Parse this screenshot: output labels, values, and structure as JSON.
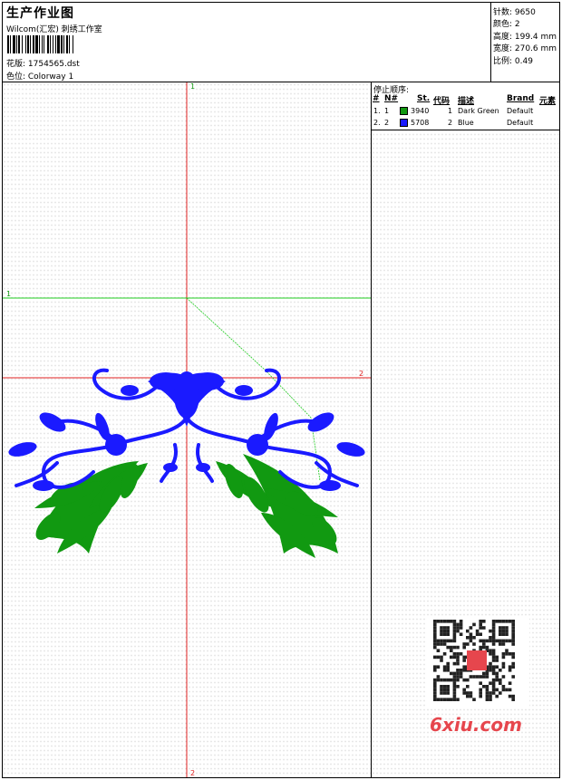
{
  "header": {
    "title": "生产作业图",
    "studio": "Wilcom(汇宏) 刺绣工作室",
    "file_label": "花版: 1754565.dst",
    "colorway_label": "色位: Colorway 1"
  },
  "stats": {
    "stitches": "针数: 9650",
    "colors": "颜色: 2",
    "height": "高度: 199.4 mm",
    "width": "宽度: 270.6 mm",
    "scale": "比例: 0.49"
  },
  "stop_sequence": {
    "caption": "停止顺序:",
    "headers": [
      "#",
      "N#",
      "St.",
      "代码",
      "描述",
      "Brand",
      "元素"
    ],
    "rows": [
      {
        "idx": "1.",
        "n": "1",
        "color": "#119911",
        "st": "3940",
        "code": "1",
        "desc": "Dark Green",
        "brand": "Default"
      },
      {
        "idx": "2.",
        "n": "2",
        "color": "#1a1aff",
        "st": "5708",
        "code": "2",
        "desc": "Blue",
        "brand": "Default"
      }
    ]
  },
  "axis_labels": {
    "v_top": "1",
    "v_bottom": "2",
    "h_left": "1",
    "h_right": "2"
  },
  "colors": {
    "green": "#119911",
    "blue": "#1a1aff",
    "red_axis": "#e02020",
    "green_axis": "#22cc22"
  },
  "watermark": {
    "brand": "6xiu.com"
  }
}
